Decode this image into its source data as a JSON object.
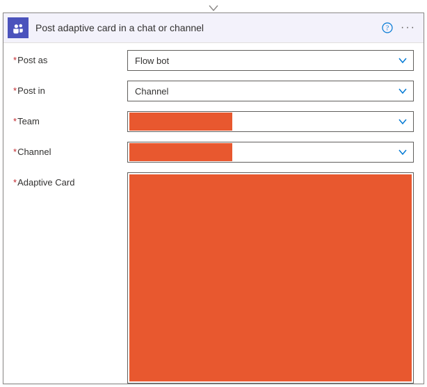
{
  "card": {
    "title": "Post adaptive card in a chat or channel",
    "icon_name": "teams-icon",
    "fields": {
      "post_as": {
        "label": "Post as",
        "value": "Flow bot",
        "required": true
      },
      "post_in": {
        "label": "Post in",
        "value": "Channel",
        "required": true
      },
      "team": {
        "label": "Team",
        "value": "",
        "required": true,
        "redacted": true
      },
      "channel": {
        "label": "Channel",
        "value": "",
        "required": true,
        "redacted": true
      },
      "adaptive_card": {
        "label": "Adaptive Card",
        "value": "",
        "required": true,
        "redacted": true
      }
    }
  },
  "colors": {
    "redaction": "#e8582f",
    "teams_purple": "#4b53bc",
    "chevron": "#0078d4"
  }
}
